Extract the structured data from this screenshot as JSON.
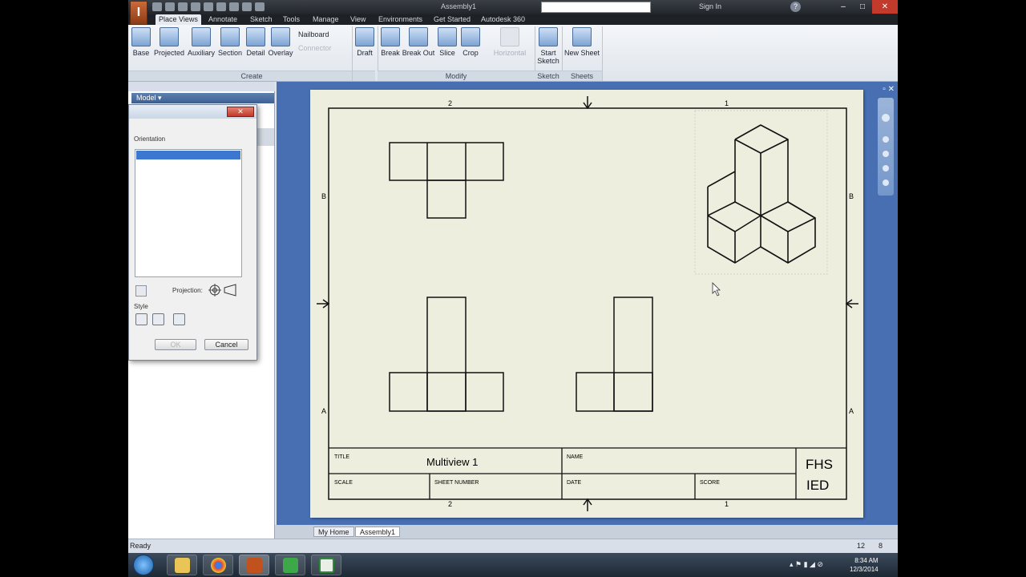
{
  "titlebar": {
    "document_title": "Assembly1",
    "sign_in": "Sign In",
    "help": "?"
  },
  "tabs": [
    "Place Views",
    "Annotate",
    "Sketch",
    "Tools",
    "Manage",
    "View",
    "Environments",
    "Get Started",
    "Autodesk 360"
  ],
  "ribbon": {
    "create_buttons": [
      "Base",
      "Projected",
      "Auxiliary",
      "Section",
      "Detail",
      "Overlay"
    ],
    "nailboard": "Nailboard",
    "connector": "Connector",
    "create_label": "Create",
    "modify_buttons": [
      "Draft",
      "Break",
      "Break Out",
      "Slice",
      "Crop",
      "Horizontal"
    ],
    "modify_label": "Modify",
    "start_sketch": "Start Sketch",
    "sketch_label": "Sketch",
    "new_sheet": "New Sheet",
    "sheets_label": "Sheets"
  },
  "browser": {
    "model_label": "Model ▾"
  },
  "dialog": {
    "orientation_label": "Orientation",
    "projection_label": "Projection:",
    "style_label": "Style",
    "ok": "OK",
    "cancel": "Cancel"
  },
  "drawing": {
    "zone_top_left": "2",
    "zone_top_right": "1",
    "zone_bottom_left": "2",
    "zone_bottom_right": "1",
    "zone_left_b": "B",
    "zone_left_a": "A",
    "zone_right_b": "B",
    "zone_right_a": "A",
    "title_label": "TITLE",
    "title_value": "Multiview 1",
    "name_label": "NAME",
    "scale_label": "SCALE",
    "sheet_number_label": "SHEET NUMBER",
    "date_label": "DATE",
    "score_label": "SCORE",
    "school_line1": "FHS",
    "school_line2": "IED"
  },
  "doc_tabs": [
    "My Home",
    "Assembly1"
  ],
  "status": {
    "text": "Ready",
    "n1": "12",
    "n2": "8"
  },
  "taskbar": {
    "time": "8:34 AM",
    "date": "12/3/2014"
  }
}
